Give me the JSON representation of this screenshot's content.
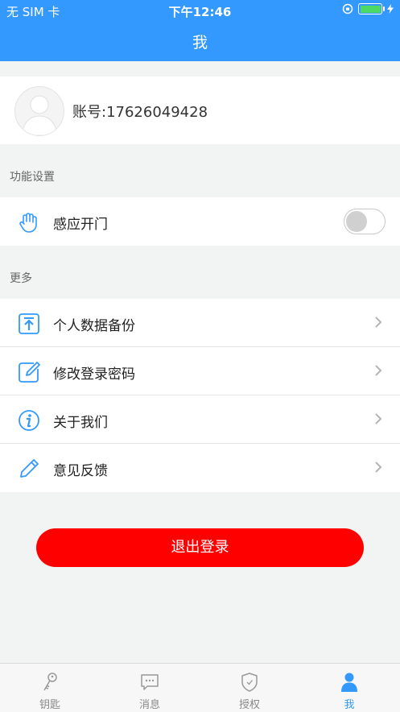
{
  "status_bar": {
    "carrier": "无 SIM 卡",
    "time": "下午12:46"
  },
  "header": {
    "title": "我"
  },
  "profile": {
    "account": "账号:17626049428"
  },
  "sections": {
    "function_settings": "功能设置",
    "more": "更多"
  },
  "settings": {
    "induction_door": {
      "label": "感应开门",
      "enabled": false
    }
  },
  "more_items": [
    {
      "label": "个人数据备份",
      "icon": "upload-icon"
    },
    {
      "label": "修改登录密码",
      "icon": "edit-icon"
    },
    {
      "label": "关于我们",
      "icon": "info-icon"
    },
    {
      "label": "意见反馈",
      "icon": "pencil-icon"
    }
  ],
  "logout_label": "退出登录",
  "tabs": [
    {
      "label": "钥匙",
      "icon": "key-icon",
      "active": false
    },
    {
      "label": "消息",
      "icon": "message-icon",
      "active": false
    },
    {
      "label": "授权",
      "icon": "shield-icon",
      "active": false
    },
    {
      "label": "我",
      "icon": "person-icon",
      "active": true
    }
  ],
  "colors": {
    "primary": "#3399ff",
    "logout": "#ff0000",
    "battery": "#4cd964"
  }
}
